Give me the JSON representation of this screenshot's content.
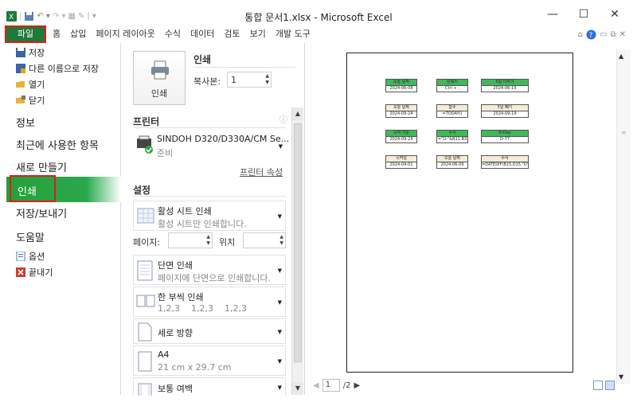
{
  "window": {
    "title": "통합 문서1.xlsx - Microsoft Excel",
    "minimize": "—",
    "maximize": "☐",
    "close": "✕"
  },
  "ribbon": {
    "tabs": [
      "파일",
      "홈",
      "삽입",
      "페이지 레이아웃",
      "수식",
      "데이터",
      "검토",
      "보기",
      "개발 도구"
    ]
  },
  "nav": {
    "small_top": [
      {
        "label": "저장",
        "icon": "save-icon"
      },
      {
        "label": "다른 이름으로 저장",
        "icon": "save-as-icon"
      },
      {
        "label": "열기",
        "icon": "open-folder-icon"
      },
      {
        "label": "닫기",
        "icon": "close-folder-icon"
      }
    ],
    "big": [
      "정보",
      "최근에 사용한 항목",
      "새로 만들기",
      "인쇄",
      "저장/보내기",
      "도움말"
    ],
    "small_bottom": [
      {
        "label": "옵션",
        "icon": "options-icon"
      },
      {
        "label": "끝내기",
        "icon": "exit-icon"
      }
    ]
  },
  "print": {
    "heading": "인쇄",
    "button_label": "인쇄",
    "copies_label": "복사본:",
    "copies_value": "1"
  },
  "printer": {
    "heading": "프린터",
    "name": "SINDOH D320/D330A/CM Se...",
    "status": "준비",
    "properties_link": "프린터 속성"
  },
  "settings": {
    "heading": "설정",
    "scope_main": "활성 시트 인쇄",
    "scope_sub": "활성 시트만 인쇄합니다.",
    "pages_label": "페이지:",
    "pages_value": "",
    "position_label": "위치",
    "position_value": "",
    "sides_main": "단면 인쇄",
    "sides_sub": "페이지에 단면으로 인쇄합니다.",
    "collate_main": "한 부씩 인쇄",
    "collate_sub": "1,2,3    1,2,3    1,2,3",
    "orientation": "세로 방향",
    "paper_main": "A4",
    "paper_sub": "21 cm x 29.7 cm",
    "margins": "보통 여백"
  },
  "preview": {
    "page_current": "1",
    "page_total": "/2",
    "cells": [
      {
        "head": "오늘 날짜",
        "value": "2024-06-08",
        "green": true
      },
      {
        "head": "단축키",
        "value": "Ctrl + ;",
        "green": true
      },
      {
        "head": "5일 더하기",
        "value": "2024-06-13",
        "green": true
      },
      {
        "head": "오늘 날짜",
        "value": "2024-09-24",
        "green": false
      },
      {
        "head": "함수",
        "value": "=TODAY()",
        "green": false
      },
      {
        "head": "5일 빼기",
        "value": "2024-09-19",
        "green": false
      },
      {
        "head": "시작 기준",
        "value": "2024-09-24",
        "green": true
      },
      {
        "head": "수식",
        "value": "=\"D-\"&B11-B3",
        "green": true
      },
      {
        "head": "D-Day",
        "value": "D-77",
        "green": true
      },
      {
        "head": "시작일",
        "value": "2024-04-01",
        "green": false
      },
      {
        "head": "오늘 날짜",
        "value": "2024-06-09",
        "green": false
      },
      {
        "head": "수식",
        "value": "=DATEDIF(B15,D15,\"D\")",
        "green": false
      }
    ]
  }
}
